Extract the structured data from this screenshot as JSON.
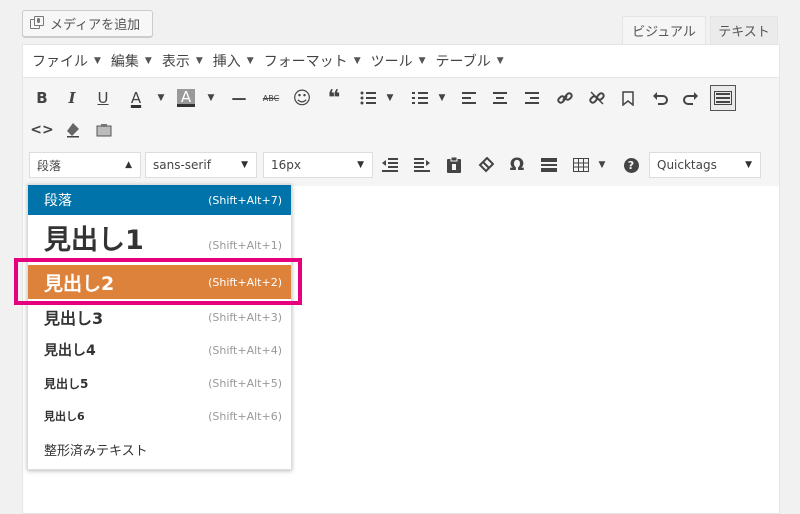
{
  "media_button": {
    "label": "メディアを追加",
    "icon": "media-add-icon"
  },
  "tabs": {
    "visual": "ビジュアル",
    "text": "テキスト"
  },
  "menubar": [
    {
      "label": "ファイル",
      "icon": "caret-down-icon"
    },
    {
      "label": "編集",
      "icon": "caret-down-icon"
    },
    {
      "label": "表示",
      "icon": "caret-down-icon"
    },
    {
      "label": "挿入",
      "icon": "caret-down-icon"
    },
    {
      "label": "フォーマット",
      "icon": "caret-down-icon"
    },
    {
      "label": "ツール",
      "icon": "caret-down-icon"
    },
    {
      "label": "テーブル",
      "icon": "caret-down-icon"
    }
  ],
  "toolbar": {
    "bold": "B",
    "italic": "I",
    "underline": "U",
    "text_color": "A",
    "bg_color": "A",
    "hr": "—",
    "strikethrough": "ABC",
    "emoticon": "☺",
    "blockquote": "❝",
    "caret": "▼"
  },
  "selects": {
    "format": "段落",
    "font_family": "sans-serif",
    "font_size": "16px",
    "quicktags": "Quicktags"
  },
  "format_dropdown": {
    "items": [
      {
        "label": "段落",
        "shortcut": "(Shift+Alt+7)"
      },
      {
        "label": "見出し1",
        "shortcut": "(Shift+Alt+1)"
      },
      {
        "label": "見出し2",
        "shortcut": "(Shift+Alt+2)"
      },
      {
        "label": "見出し3",
        "shortcut": "(Shift+Alt+3)"
      },
      {
        "label": "見出し4",
        "shortcut": "(Shift+Alt+4)"
      },
      {
        "label": "見出し5",
        "shortcut": "(Shift+Alt+5)"
      },
      {
        "label": "見出し6",
        "shortcut": "(Shift+Alt+6)"
      },
      {
        "label": "整形済みテキスト",
        "shortcut": ""
      }
    ],
    "selected_color": "#0073aa",
    "hover_color": "#dd823b"
  },
  "colors": {
    "highlight_frame": "#e6007e",
    "editor_bg": "#ffffff",
    "toolbar_bg": "#f5f5f5"
  }
}
